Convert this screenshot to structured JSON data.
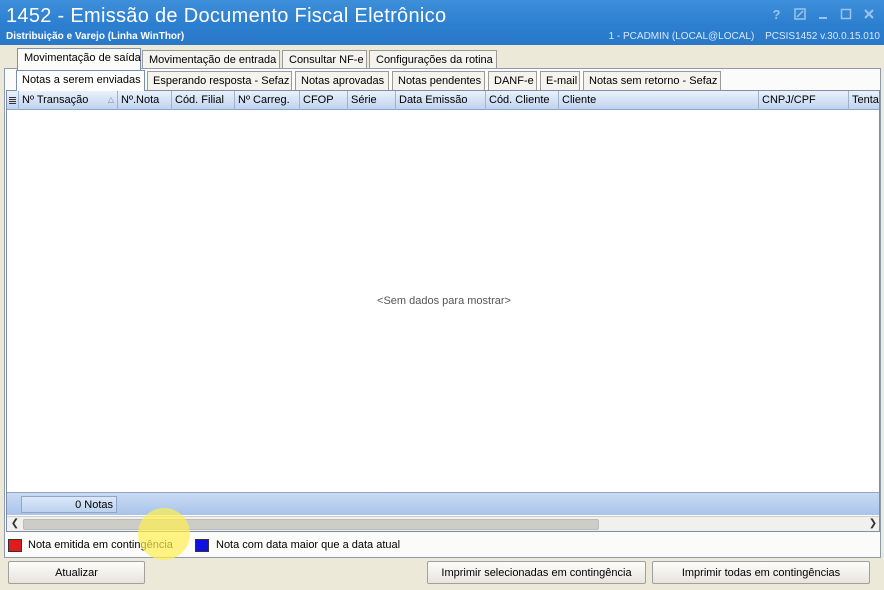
{
  "window": {
    "title": "1452 - Emissão de Documento Fiscal Eletrônico",
    "subtitle": "Distribuição e Varejo (Linha WinThor)",
    "user_info": "1 - PCADMIN (LOCAL@LOCAL)",
    "version_info": "PCSIS1452  v.30.0.15.010",
    "controls": [
      "?",
      "minimize",
      "restore",
      "close"
    ]
  },
  "main_tabs": [
    {
      "label": "Movimentação de saída",
      "active": true
    },
    {
      "label": "Movimentação de entrada",
      "active": false
    },
    {
      "label": "Consultar NF-e",
      "active": false
    },
    {
      "label": "Configurações da rotina",
      "active": false
    }
  ],
  "sub_tabs": [
    {
      "label": "Notas a serem enviadas",
      "active": true
    },
    {
      "label": "Esperando resposta - Sefaz",
      "active": false
    },
    {
      "label": "Notas aprovadas",
      "active": false
    },
    {
      "label": "Notas pendentes",
      "active": false
    },
    {
      "label": "DANF-e",
      "active": false
    },
    {
      "label": "E-mail",
      "active": false
    },
    {
      "label": "Notas sem retorno - Sefaz",
      "active": false
    }
  ],
  "grid": {
    "columns": [
      "Nº Transação",
      "Nº.Nota",
      "Cód. Filial",
      "Nº Carreg.",
      "CFOP",
      "Série",
      "Data Emissão",
      "Cód. Cliente",
      "Cliente",
      "CNPJ/CPF",
      "Tenta"
    ],
    "empty_message": "<Sem dados para mostrar>",
    "footer_count": "0 Notas"
  },
  "legend": [
    {
      "color": "#e01b1b",
      "label": "Nota emitida em contingência"
    },
    {
      "color": "#1010e0",
      "label": "Nota com data maior que a data atual"
    }
  ],
  "buttons": {
    "refresh": "Atualizar",
    "print_selected": "Imprimir selecionadas em contingência",
    "print_all": "Imprimir todas em contingências"
  }
}
